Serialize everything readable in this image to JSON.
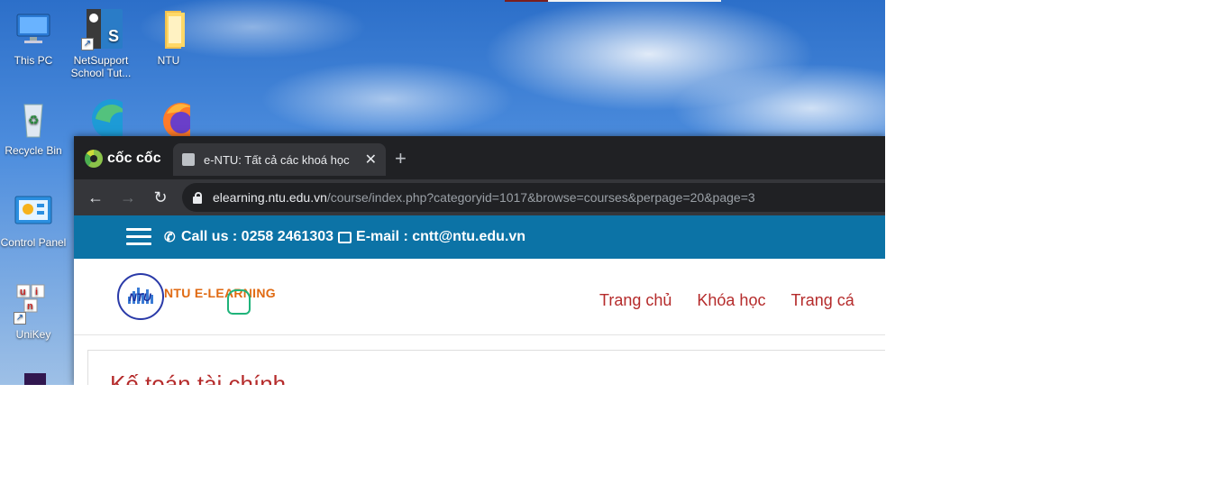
{
  "desktop": {
    "icons": [
      {
        "label": "This PC",
        "icon": "computer-icon"
      },
      {
        "label": "NetSupport School Tut...",
        "icon": "netsupport-icon"
      },
      {
        "label": "NTU",
        "icon": "folder-icon"
      },
      {
        "label": "Recycle Bin",
        "icon": "recycle-bin-icon"
      },
      {
        "label": "",
        "icon": "edge-icon"
      },
      {
        "label": "",
        "icon": "firefox-icon"
      },
      {
        "label": "Control Panel",
        "icon": "control-panel-icon"
      },
      {
        "label": "UniKey",
        "icon": "unikey-icon"
      },
      {
        "label": "",
        "icon": "adobe-icon"
      }
    ],
    "netsupport_lines": [
      "NetSupport",
      "School Tut..."
    ]
  },
  "browser": {
    "brand": "cốc cốc",
    "tab_title": "e-NTU: Tất cả các khoá học",
    "url_domain": "elearning.ntu.edu.vn",
    "url_path": "/course/index.php?categoryid=1017&browse=courses&perpage=20&page=3"
  },
  "site": {
    "call_text": "Call us : 0258 2461303",
    "email_text": "E-mail : cntt@ntu.edu.vn",
    "logo_text": "NTU E-LEARNING",
    "logo_badge": "NTU",
    "nav": [
      "Trang chủ",
      "Khóa học",
      "Trang cá"
    ],
    "course_title": "Kế toán tài chính"
  },
  "colors": {
    "topbar": "#0c73a6",
    "nav_link": "#b52b2b",
    "logo_text": "#e06a12"
  }
}
